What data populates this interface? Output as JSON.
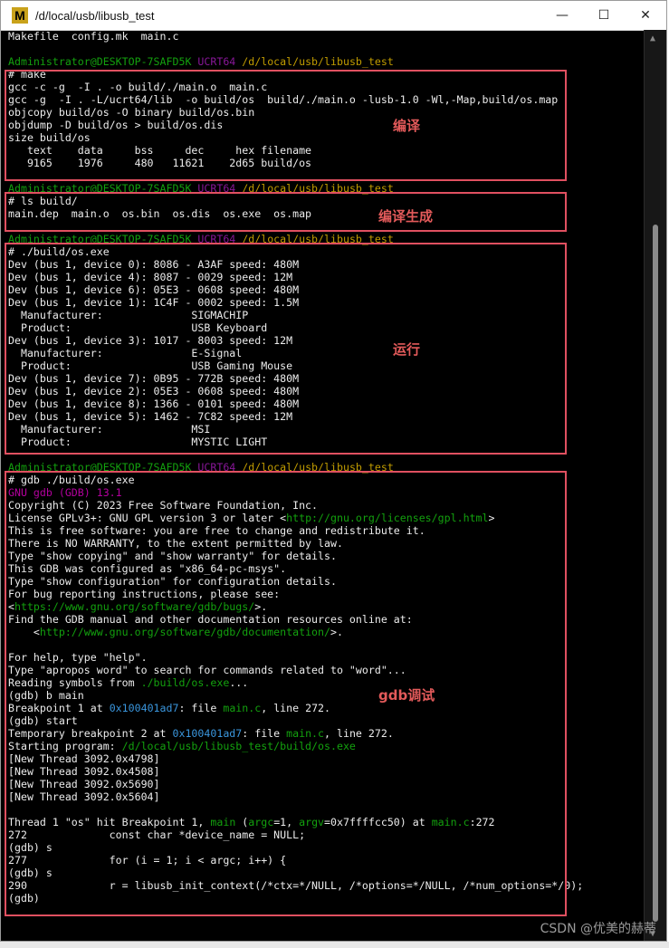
{
  "window": {
    "title": "/d/local/usb/libusb_test",
    "icon_letter": "M",
    "minimize": "—",
    "maximize": "☐",
    "close": "✕"
  },
  "terminal": {
    "lines": [
      [
        {
          "t": "Makefile  config.mk  main.c",
          "c": ""
        }
      ],
      [
        {
          "t": "",
          "c": ""
        }
      ],
      [
        {
          "t": "Administrator@DESKTOP-7SAFD5K ",
          "c": "prompt-user"
        },
        {
          "t": "UCRT64 ",
          "c": "prompt-mid"
        },
        {
          "t": "/d/local/usb/libusb_test",
          "c": "prompt-path"
        }
      ],
      [
        {
          "t": "# make",
          "c": ""
        }
      ],
      [
        {
          "t": "gcc -c -g  -I . -o build/./main.o  main.c",
          "c": ""
        }
      ],
      [
        {
          "t": "gcc -g  -I . -L/ucrt64/lib  -o build/os  build/./main.o -lusb-1.0 -Wl,-Map,build/os.map",
          "c": ""
        }
      ],
      [
        {
          "t": "objcopy build/os -O binary build/os.bin",
          "c": ""
        }
      ],
      [
        {
          "t": "objdump -D build/os > build/os.dis",
          "c": ""
        }
      ],
      [
        {
          "t": "size build/os",
          "c": ""
        }
      ],
      [
        {
          "t": "   text    data     bss     dec     hex filename",
          "c": ""
        }
      ],
      [
        {
          "t": "   9165    1976     480   11621    2d65 build/os",
          "c": ""
        }
      ],
      [
        {
          "t": "",
          "c": ""
        }
      ],
      [
        {
          "t": "Administrator@DESKTOP-7SAFD5K ",
          "c": "prompt-user"
        },
        {
          "t": "UCRT64 ",
          "c": "prompt-mid"
        },
        {
          "t": "/d/local/usb/libusb_test",
          "c": "prompt-path"
        }
      ],
      [
        {
          "t": "# ls build/",
          "c": ""
        }
      ],
      [
        {
          "t": "main.dep  main.o  os.bin  os.dis  os.exe  os.map",
          "c": ""
        }
      ],
      [
        {
          "t": "",
          "c": ""
        }
      ],
      [
        {
          "t": "Administrator@DESKTOP-7SAFD5K ",
          "c": "prompt-user"
        },
        {
          "t": "UCRT64 ",
          "c": "prompt-mid"
        },
        {
          "t": "/d/local/usb/libusb_test",
          "c": "prompt-path"
        }
      ],
      [
        {
          "t": "# ./build/os.exe",
          "c": ""
        }
      ],
      [
        {
          "t": "Dev (bus 1, device 0): 8086 - A3AF speed: 480M",
          "c": ""
        }
      ],
      [
        {
          "t": "Dev (bus 1, device 4): 8087 - 0029 speed: 12M",
          "c": ""
        }
      ],
      [
        {
          "t": "Dev (bus 1, device 6): 05E3 - 0608 speed: 480M",
          "c": ""
        }
      ],
      [
        {
          "t": "Dev (bus 1, device 1): 1C4F - 0002 speed: 1.5M",
          "c": ""
        }
      ],
      [
        {
          "t": "  Manufacturer:              SIGMACHIP",
          "c": ""
        }
      ],
      [
        {
          "t": "  Product:                   USB Keyboard",
          "c": ""
        }
      ],
      [
        {
          "t": "Dev (bus 1, device 3): 1017 - 8003 speed: 12M",
          "c": ""
        }
      ],
      [
        {
          "t": "  Manufacturer:              E-Signal",
          "c": ""
        }
      ],
      [
        {
          "t": "  Product:                   USB Gaming Mouse",
          "c": ""
        }
      ],
      [
        {
          "t": "Dev (bus 1, device 7): 0B95 - 772B speed: 480M",
          "c": ""
        }
      ],
      [
        {
          "t": "Dev (bus 1, device 2): 05E3 - 0608 speed: 480M",
          "c": ""
        }
      ],
      [
        {
          "t": "Dev (bus 1, device 8): 1366 - 0101 speed: 480M",
          "c": ""
        }
      ],
      [
        {
          "t": "Dev (bus 1, device 5): 1462 - 7C82 speed: 12M",
          "c": ""
        }
      ],
      [
        {
          "t": "  Manufacturer:              MSI",
          "c": ""
        }
      ],
      [
        {
          "t": "  Product:                   MYSTIC LIGHT",
          "c": ""
        }
      ],
      [
        {
          "t": "",
          "c": ""
        }
      ],
      [
        {
          "t": "Administrator@DESKTOP-7SAFD5K ",
          "c": "prompt-user"
        },
        {
          "t": "UCRT64 ",
          "c": "prompt-mid"
        },
        {
          "t": "/d/local/usb/libusb_test",
          "c": "prompt-path"
        }
      ],
      [
        {
          "t": "# gdb ./build/os.exe",
          "c": ""
        }
      ],
      [
        {
          "t": "GNU gdb (GDB) 13.1",
          "c": "gdb-mag"
        }
      ],
      [
        {
          "t": "Copyright (C) 2023 Free Software Foundation, Inc.",
          "c": ""
        }
      ],
      [
        {
          "t": "License GPLv3+: GNU GPL version 3 or later <",
          "c": ""
        },
        {
          "t": "http://gnu.org/licenses/gpl.html",
          "c": "gdb-green"
        },
        {
          "t": ">",
          "c": ""
        }
      ],
      [
        {
          "t": "This is free software: you are free to change and redistribute it.",
          "c": ""
        }
      ],
      [
        {
          "t": "There is NO WARRANTY, to the extent permitted by law.",
          "c": ""
        }
      ],
      [
        {
          "t": "Type \"show copying\" and \"show warranty\" for details.",
          "c": ""
        }
      ],
      [
        {
          "t": "This GDB was configured as \"x86_64-pc-msys\".",
          "c": ""
        }
      ],
      [
        {
          "t": "Type \"show configuration\" for configuration details.",
          "c": ""
        }
      ],
      [
        {
          "t": "For bug reporting instructions, please see:",
          "c": ""
        }
      ],
      [
        {
          "t": "<",
          "c": ""
        },
        {
          "t": "https://www.gnu.org/software/gdb/bugs/",
          "c": "gdb-green"
        },
        {
          "t": ">.",
          "c": ""
        }
      ],
      [
        {
          "t": "Find the GDB manual and other documentation resources online at:",
          "c": ""
        }
      ],
      [
        {
          "t": "    <",
          "c": ""
        },
        {
          "t": "http://www.gnu.org/software/gdb/documentation/",
          "c": "gdb-green"
        },
        {
          "t": ">.",
          "c": ""
        }
      ],
      [
        {
          "t": "",
          "c": ""
        }
      ],
      [
        {
          "t": "For help, type \"help\".",
          "c": ""
        }
      ],
      [
        {
          "t": "Type \"apropos word\" to search for commands related to \"word\"...",
          "c": ""
        }
      ],
      [
        {
          "t": "Reading symbols from ",
          "c": ""
        },
        {
          "t": "./build/os.exe",
          "c": "gdb-green"
        },
        {
          "t": "...",
          "c": ""
        }
      ],
      [
        {
          "t": "(gdb) b main",
          "c": ""
        }
      ],
      [
        {
          "t": "Breakpoint 1 at ",
          "c": ""
        },
        {
          "t": "0x100401ad7",
          "c": "gdb-blue"
        },
        {
          "t": ": file ",
          "c": ""
        },
        {
          "t": "main.c",
          "c": "gdb-green"
        },
        {
          "t": ", line 272.",
          "c": ""
        }
      ],
      [
        {
          "t": "(gdb) start",
          "c": ""
        }
      ],
      [
        {
          "t": "Temporary breakpoint 2 at ",
          "c": ""
        },
        {
          "t": "0x100401ad7",
          "c": "gdb-blue"
        },
        {
          "t": ": file ",
          "c": ""
        },
        {
          "t": "main.c",
          "c": "gdb-green"
        },
        {
          "t": ", line 272.",
          "c": ""
        }
      ],
      [
        {
          "t": "Starting program: ",
          "c": ""
        },
        {
          "t": "/d/local/usb/libusb_test/build/os.exe",
          "c": "gdb-green"
        }
      ],
      [
        {
          "t": "[New Thread 3092.0x4798]",
          "c": ""
        }
      ],
      [
        {
          "t": "[New Thread 3092.0x4508]",
          "c": ""
        }
      ],
      [
        {
          "t": "[New Thread 3092.0x5690]",
          "c": ""
        }
      ],
      [
        {
          "t": "[New Thread 3092.0x5604]",
          "c": ""
        }
      ],
      [
        {
          "t": "",
          "c": ""
        }
      ],
      [
        {
          "t": "Thread 1 \"os\" hit Breakpoint 1, ",
          "c": ""
        },
        {
          "t": "main",
          "c": "gdb-green"
        },
        {
          "t": " (",
          "c": ""
        },
        {
          "t": "argc",
          "c": "gdb-green"
        },
        {
          "t": "=1, ",
          "c": ""
        },
        {
          "t": "argv",
          "c": "gdb-green"
        },
        {
          "t": "=0x7ffffcc50) at ",
          "c": ""
        },
        {
          "t": "main.c",
          "c": "gdb-green"
        },
        {
          "t": ":272",
          "c": ""
        }
      ],
      [
        {
          "t": "272             const char *device_name = NULL;",
          "c": ""
        }
      ],
      [
        {
          "t": "(gdb) s",
          "c": ""
        }
      ],
      [
        {
          "t": "277             for (i = 1; i < argc; i++) {",
          "c": ""
        }
      ],
      [
        {
          "t": "(gdb) s",
          "c": ""
        }
      ],
      [
        {
          "t": "290             r = libusb_init_context(/*ctx=*/NULL, /*options=*/NULL, /*num_options=*/0);",
          "c": ""
        }
      ],
      [
        {
          "t": "(gdb)",
          "c": ""
        }
      ]
    ]
  },
  "annotations": {
    "compile": "编译",
    "compile_output": "编译生成",
    "run": "运行",
    "gdb_debug": "gdb调试"
  },
  "watermark": "CSDN @优美的赫蒂",
  "colors": {
    "annotation_red": "#e35a5a",
    "box_red": "#e05060",
    "prompt_green": "#13a10e",
    "prompt_magenta": "#881798",
    "prompt_yellow": "#c19c00"
  }
}
